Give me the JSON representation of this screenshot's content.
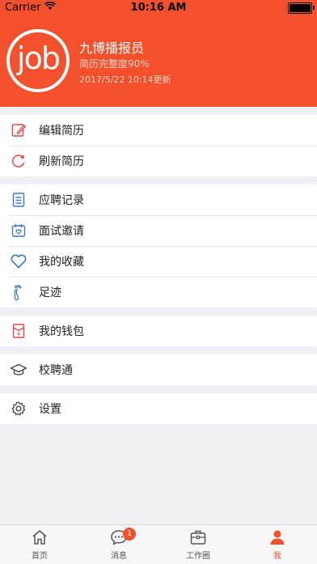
{
  "status_bar": {
    "carrier": "Carrier",
    "time": "10:16 AM"
  },
  "profile": {
    "logo_text": "job",
    "name": "九博播报员",
    "completion": "简历完整度90%",
    "updated": "2017/5/22 10:14更新"
  },
  "menu": {
    "group1": [
      {
        "label": "编辑简历",
        "icon": "edit-icon"
      },
      {
        "label": "刷新简历",
        "icon": "refresh-icon"
      }
    ],
    "group2": [
      {
        "label": "应聘记录",
        "icon": "document-list-icon"
      },
      {
        "label": "面试邀请",
        "icon": "calendar-heart-icon"
      },
      {
        "label": "我的收藏",
        "icon": "heart-icon"
      },
      {
        "label": "足迹",
        "icon": "footprint-icon"
      }
    ],
    "group3": [
      {
        "label": "我的钱包",
        "icon": "wallet-icon"
      }
    ],
    "group4": [
      {
        "label": "校聘通",
        "icon": "graduation-cap-icon"
      }
    ],
    "group5": [
      {
        "label": "设置",
        "icon": "gear-icon"
      }
    ]
  },
  "tabs": [
    {
      "label": "首页",
      "icon": "home-icon"
    },
    {
      "label": "消息",
      "icon": "chat-icon",
      "badge": "1"
    },
    {
      "label": "工作圈",
      "icon": "briefcase-icon"
    },
    {
      "label": "我",
      "icon": "person-icon"
    }
  ],
  "colors": {
    "accent": "#f4502b",
    "icon_red": "#e8454a",
    "icon_blue": "#3a79c9"
  }
}
